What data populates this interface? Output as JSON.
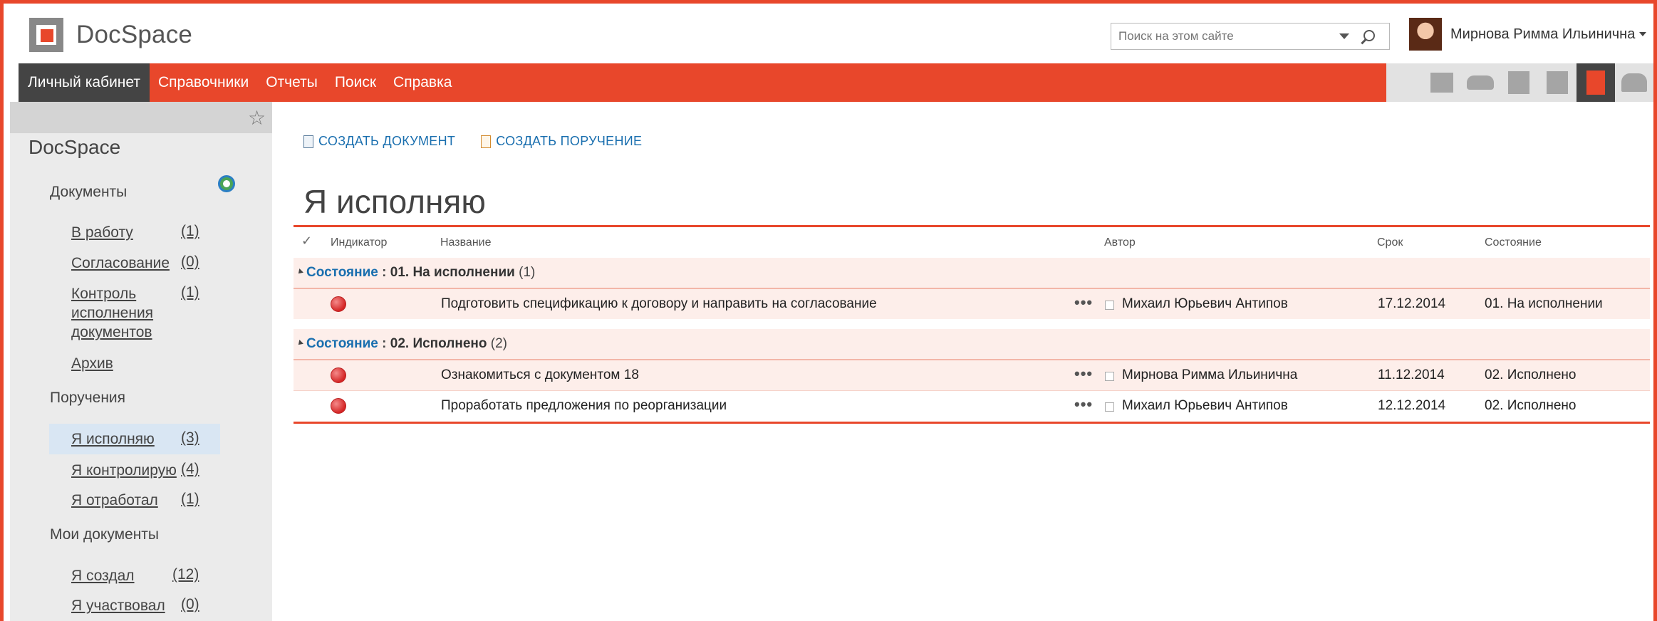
{
  "app": {
    "logo_text": "DocSpace"
  },
  "search": {
    "placeholder": "Поиск на этом сайте"
  },
  "user": {
    "name": "Мирнова Римма Ильинична"
  },
  "nav": {
    "items": [
      "Личный кабинет",
      "Справочники",
      "Отчеты",
      "Поиск",
      "Справка"
    ]
  },
  "icons": [
    "news-icon",
    "onedrive-cloud-icon",
    "sharepoint-icon",
    "project-icon",
    "docspace-transfer-icon",
    "users-icon"
  ],
  "sidebar": {
    "title": "DocSpace",
    "sections": [
      {
        "label": "Документы"
      },
      {
        "label": "Поручения"
      },
      {
        "label": "Мои документы"
      }
    ],
    "links": [
      {
        "label": "В работу",
        "count": "(1)"
      },
      {
        "label": "Согласование",
        "count": "(0)"
      },
      {
        "label_lines": [
          "Контроль",
          "исполнения",
          "документов"
        ],
        "count": "(1)"
      },
      {
        "label": "Архив"
      },
      {
        "label": "Я исполняю",
        "count": "(3)"
      },
      {
        "label": "Я контролирую",
        "count": "(4)"
      },
      {
        "label": "Я отработал",
        "count": "(1)"
      },
      {
        "label": "Я создал",
        "count": "(12)"
      },
      {
        "label": "Я участвовал",
        "count": "(0)"
      }
    ]
  },
  "actions": {
    "create_document": "СОЗДАТЬ ДОКУМЕНТ",
    "create_task": "СОЗДАТЬ ПОРУЧЕНИЕ"
  },
  "page": {
    "title": "Я исполняю"
  },
  "table": {
    "check_header": "✓",
    "columns": [
      "Индикатор",
      "Название",
      "Автор",
      "Срок",
      "Состояние"
    ],
    "groups": [
      {
        "key": "Состояние",
        "separator": " : ",
        "value": "01. На исполнении",
        "count": "(1)",
        "rows": [
          {
            "title": "Подготовить спецификацию к договору и направить на согласование",
            "author": "Михаил Юрьевич Антипов",
            "due": "17.12.2014",
            "state": "01. На исполнении"
          }
        ]
      },
      {
        "key": "Состояние",
        "separator": " : ",
        "value": "02. Исполнено",
        "count": "(2)",
        "rows": [
          {
            "title": "Ознакомиться с документом 18",
            "author": "Мирнова Римма Ильинична",
            "due": "11.12.2014",
            "state": "02. Исполнено"
          },
          {
            "title": "Проработать предложения по реорганизации",
            "author": "Михаил Юрьевич Антипов",
            "due": "12.12.2014",
            "state": "02. Исполнено"
          }
        ]
      }
    ],
    "row_menu": "•••"
  },
  "colors": {
    "accent": "#e8472b",
    "link": "#1a6faf",
    "nav_active": "#444444"
  }
}
